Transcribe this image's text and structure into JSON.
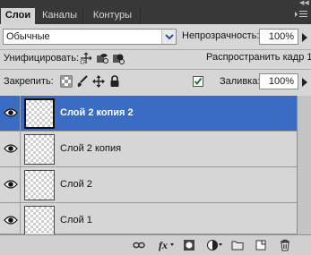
{
  "tabs": [
    {
      "label": "Слои",
      "active": true
    },
    {
      "label": "Каналы",
      "active": false
    },
    {
      "label": "Контуры",
      "active": false
    }
  ],
  "blend_mode": {
    "value": "Обычные"
  },
  "opacity": {
    "label": "Непрозрачность:",
    "value": "100%"
  },
  "unify": {
    "label": "Унифицировать:",
    "icons": [
      "unify-position-icon",
      "unify-visibility-icon",
      "unify-style-icon"
    ]
  },
  "propagate": {
    "label": "Распространить кадр 1",
    "checked": true
  },
  "lock": {
    "label": "Закрепить:",
    "icons": [
      "lock-transparent-icon",
      "lock-paint-icon",
      "lock-move-icon",
      "lock-all-icon"
    ]
  },
  "fill": {
    "label": "Заливка:",
    "value": "100%"
  },
  "layers": [
    {
      "name": "Слой 2 копия 2",
      "selected": true,
      "visible": true
    },
    {
      "name": "Слой 2 копия",
      "selected": false,
      "visible": true
    },
    {
      "name": "Слой 2",
      "selected": false,
      "visible": true
    },
    {
      "name": "Слой 1",
      "selected": false,
      "visible": true
    }
  ],
  "bottom_icons": [
    "link-layers-icon",
    "fx-icon",
    "layer-mask-icon",
    "adjustment-layer-icon",
    "new-group-icon",
    "new-layer-icon",
    "trash-icon"
  ],
  "colors": {
    "selected_row": "#3a6cc4",
    "panel": "#d6d6d6",
    "tabbar": "#383838"
  }
}
